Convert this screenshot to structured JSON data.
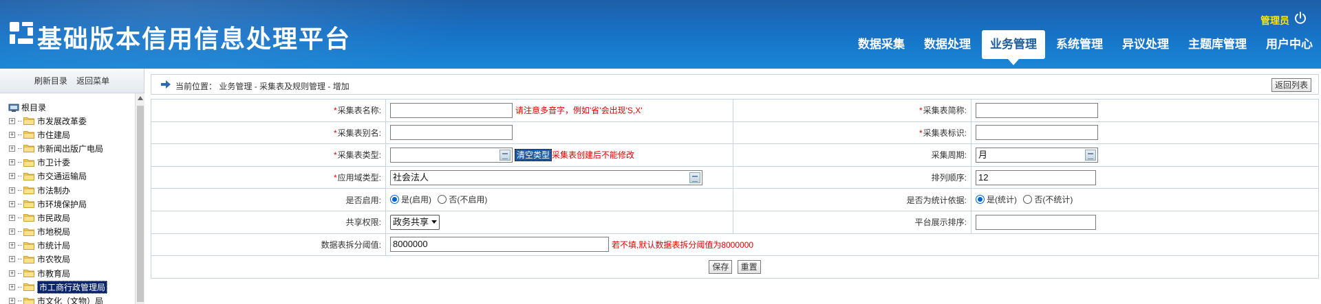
{
  "header": {
    "brand": "基础版本信用信息处理平台",
    "admin_label": "管理员",
    "nav": [
      {
        "label": "数据采集",
        "active": false
      },
      {
        "label": "数据处理",
        "active": false
      },
      {
        "label": "业务管理",
        "active": true
      },
      {
        "label": "系统管理",
        "active": false
      },
      {
        "label": "异议处理",
        "active": false
      },
      {
        "label": "主题库管理",
        "active": false
      },
      {
        "label": "用户中心",
        "active": false
      }
    ]
  },
  "sidebar": {
    "refresh_label": "刷新目录",
    "back_menu_label": "返回菜单",
    "root_label": "根目录",
    "items": [
      {
        "label": "市发展改革委",
        "selected": false
      },
      {
        "label": "市住建局",
        "selected": false
      },
      {
        "label": "市新闻出版广电局",
        "selected": false
      },
      {
        "label": "市卫计委",
        "selected": false
      },
      {
        "label": "市交通运输局",
        "selected": false
      },
      {
        "label": "市法制办",
        "selected": false
      },
      {
        "label": "市环境保护局",
        "selected": false
      },
      {
        "label": "市民政局",
        "selected": false
      },
      {
        "label": "市地税局",
        "selected": false
      },
      {
        "label": "市统计局",
        "selected": false
      },
      {
        "label": "市农牧局",
        "selected": false
      },
      {
        "label": "市教育局",
        "selected": false
      },
      {
        "label": "市工商行政管理局",
        "selected": true
      },
      {
        "label": "市文化（文物）局",
        "selected": false
      }
    ]
  },
  "breadcrumb": {
    "prefix": "当前位置：",
    "path": "业务管理 - 采集表及规则管理 - 增加",
    "back_button": "返回列表"
  },
  "form": {
    "table_name": {
      "label": "采集表名称:",
      "value": "",
      "hint": "请注意多音字，例如'省'会出现'S,X'"
    },
    "short_name": {
      "label": "采集表简称:",
      "value": ""
    },
    "alias": {
      "label": "采集表别名:",
      "value": ""
    },
    "identifier": {
      "label": "采集表标识:",
      "value": ""
    },
    "type": {
      "label": "采集表类型:",
      "value": "",
      "clear_label": "清空类型",
      "hint": "采集表创建后不能修改"
    },
    "period": {
      "label": "采集周期:",
      "value": "月"
    },
    "domain": {
      "label": "应用域类型:",
      "value": "社会法人"
    },
    "order": {
      "label": "排列顺序:",
      "value": "12"
    },
    "enabled": {
      "label": "是否启用:",
      "options": [
        "是(启用)",
        "否(不启用)"
      ],
      "selected": 0
    },
    "stat_basis": {
      "label": "是否为统计依据:",
      "options": [
        "是(统计)",
        "否(不统计)"
      ],
      "selected": 0
    },
    "share": {
      "label": "共享权限:",
      "value": "政务共享"
    },
    "platform_order": {
      "label": "平台展示排序:",
      "value": ""
    },
    "split_threshold": {
      "label": "数据表拆分阈值:",
      "value": "8000000",
      "hint": "若不填,默认数据表拆分阈值为8000000"
    }
  },
  "buttons": {
    "save": "保存",
    "reset": "重置"
  }
}
